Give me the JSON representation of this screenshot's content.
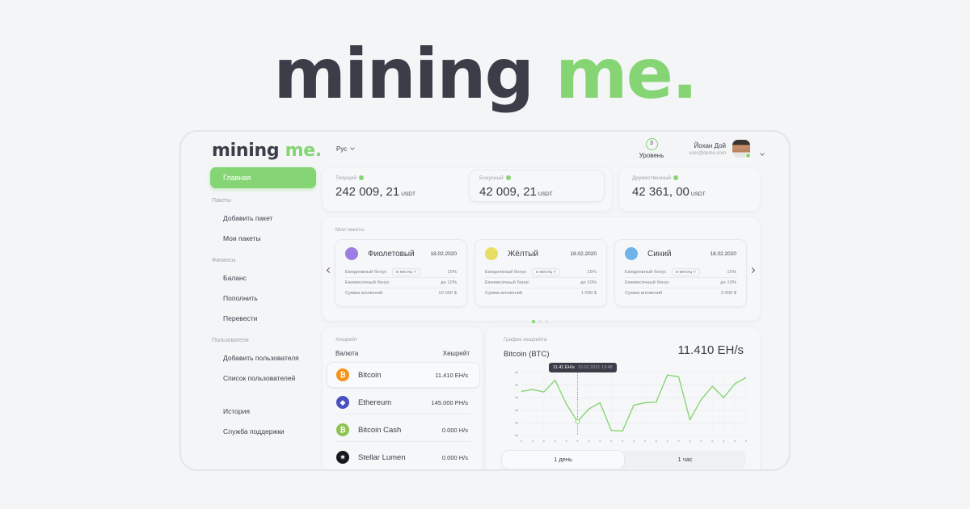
{
  "hero": {
    "logo_main": "mining",
    "logo_accent": "me."
  },
  "sidebar": {
    "logo_main": "mining",
    "logo_accent": "me.",
    "active_item": "Главная",
    "sections": {
      "packages": {
        "title": "Пакеты",
        "items": [
          "Добавить пакет",
          "Мои пакеты"
        ]
      },
      "finance": {
        "title": "Финансы",
        "items": [
          "Баланс",
          "Пополнить",
          "Перевести"
        ]
      },
      "users": {
        "title": "Пользователи",
        "items": [
          "Добавить пользователя",
          "Список пользователей"
        ]
      },
      "other": {
        "items": [
          "История",
          "Служба поддержки"
        ]
      }
    }
  },
  "topbar": {
    "language": "Рус",
    "level": {
      "number": "3",
      "label": "Уровень"
    },
    "user": {
      "name": "Йохан Дой",
      "email": "user@demo.com"
    }
  },
  "balances": {
    "current": {
      "label": "Текущий",
      "value": "242 009, 21",
      "currency": "USDT"
    },
    "bonus": {
      "label": "Бонусный",
      "value": "42 009, 21",
      "currency": "USDT"
    },
    "friendly": {
      "label": "Дружественный",
      "value": "42 361, 00",
      "currency": "USDT"
    }
  },
  "my_packages": {
    "title": "Мои пакеты",
    "items": [
      {
        "name": "Фиолетовый",
        "date": "18.02.2020",
        "color": "#9b7fe0",
        "daily_bonus_label": "Ежедневный бонус",
        "period": "в месяц",
        "daily_bonus": "15%",
        "monthly_bonus_label": "Ежемесячный бонус",
        "monthly_bonus": "до 10%",
        "investment_label": "Сумма вложений",
        "investment": "10 000 $"
      },
      {
        "name": "Жёлтый",
        "date": "18.02.2020",
        "color": "#e9dd63",
        "daily_bonus_label": "Ежедневный бонус",
        "period": "в месяц",
        "daily_bonus": "15%",
        "monthly_bonus_label": "Ежемесячный бонус",
        "monthly_bonus": "до 10%",
        "investment_label": "Сумма вложений",
        "investment": "1 000 $"
      },
      {
        "name": "Синий",
        "date": "18.02.2020",
        "color": "#6fb3e8",
        "daily_bonus_label": "Ежедневный бонус",
        "period": "в месяц",
        "daily_bonus": "15%",
        "monthly_bonus_label": "Ежемесячный бонус",
        "monthly_bonus": "до 10%",
        "investment_label": "Сумма вложений",
        "investment": "3 000 $"
      }
    ],
    "pagination": {
      "pages": 3,
      "active": 1
    }
  },
  "hashrate": {
    "title": "Хешрейт",
    "col_currency": "Валюта",
    "col_hashrate": "Хешрейт",
    "coins": [
      {
        "name": "Bitcoin",
        "rate": "11.410 EH/s",
        "icon": "bitcoin-icon",
        "color": "#f7931a",
        "glyph": "₿"
      },
      {
        "name": "Ethereum",
        "rate": "145.000 PH/s",
        "icon": "ethereum-icon",
        "color": "#4a4fc4",
        "glyph": "◆"
      },
      {
        "name": "Bitcoin Cash",
        "rate": "0.000 H/s",
        "icon": "bitcoin-cash-icon",
        "color": "#8dc351",
        "glyph": "₿"
      },
      {
        "name": "Stellar Lumen",
        "rate": "0.000 H/s",
        "icon": "stellar-icon",
        "color": "#14181f",
        "glyph": "✷"
      }
    ]
  },
  "hashrate_chart": {
    "title": "График хешрейта",
    "coin": "Bitcoin (BTC)",
    "current": "11.410 EH/s",
    "tooltip": {
      "value": "11.41 EH/s",
      "time": "10.02.2021 13:48"
    },
    "tabs": [
      "1 день",
      "1 час"
    ],
    "active_tab": 0
  },
  "chart_data": {
    "type": "line",
    "series": [
      {
        "values": [
          0.7,
          0.73,
          0.69,
          0.88,
          0.5,
          0.22,
          0.42,
          0.52,
          0.08,
          0.07,
          0.48,
          0.52,
          0.53,
          0.96,
          0.93,
          0.25,
          0.57,
          0.78,
          0.6,
          0.82,
          0.92
        ]
      }
    ],
    "highlight_index": 5,
    "grid": true,
    "color": "#86d574"
  }
}
